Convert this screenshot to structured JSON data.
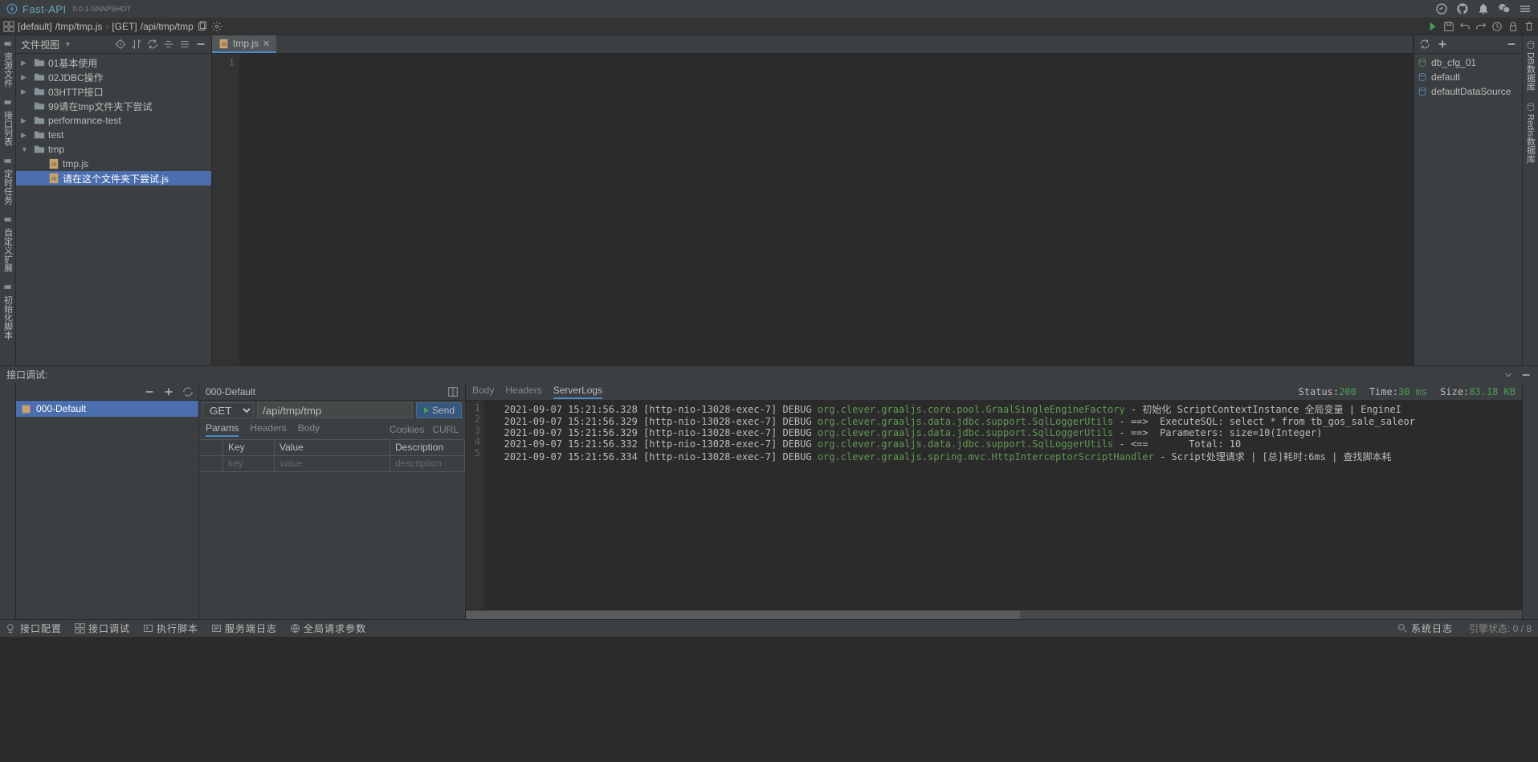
{
  "titlebar": {
    "app_name": "Fast-API",
    "version": "0.0.1-SNAPSHOT"
  },
  "breadcrumb": {
    "default_label": "[default]",
    "path": "/tmp/tmp.js",
    "method": "[GET]",
    "api_path": "/api/tmp/tmp"
  },
  "file_panel": {
    "title": "文件视图"
  },
  "tree": [
    {
      "type": "folder",
      "arrow": "▶",
      "label": "01基本使用",
      "indent": 0,
      "sel": false
    },
    {
      "type": "folder",
      "arrow": "▶",
      "label": "02JDBC操作",
      "indent": 0,
      "sel": false
    },
    {
      "type": "folder",
      "arrow": "▶",
      "label": "03HTTP接口",
      "indent": 0,
      "sel": false
    },
    {
      "type": "folder",
      "arrow": "",
      "label": "99请在tmp文件夹下尝试",
      "indent": 0,
      "sel": false
    },
    {
      "type": "folder",
      "arrow": "▶",
      "label": "performance-test",
      "indent": 0,
      "sel": false
    },
    {
      "type": "folder",
      "arrow": "▶",
      "label": "test",
      "indent": 0,
      "sel": false
    },
    {
      "type": "folder",
      "arrow": "▼",
      "label": "tmp",
      "indent": 0,
      "sel": false
    },
    {
      "type": "js",
      "arrow": "",
      "label": "tmp.js",
      "indent": 1,
      "sel": false
    },
    {
      "type": "js",
      "arrow": "",
      "label": "请在这个文件夹下尝试.js",
      "indent": 1,
      "sel": true
    }
  ],
  "editor": {
    "tab_label": "tmp.js",
    "line_no": "1"
  },
  "db": {
    "items": [
      {
        "label": "db_cfg_01",
        "color": "#629755"
      },
      {
        "label": "default",
        "color": "#5691c8"
      },
      {
        "label": "defaultDataSource",
        "color": "#5691c8"
      }
    ]
  },
  "side_left": [
    "资源文件",
    "接口列表",
    "定时任务",
    "自定义扩展",
    "初始化脚本"
  ],
  "side_right": [
    "DB数据库",
    "Redis数据库"
  ],
  "debug": {
    "title": "接口调试:",
    "req_label": "000-Default",
    "method": "GET",
    "path": "/api/tmp/tmp",
    "send": "Send",
    "tabs_left": [
      "Params",
      "Headers",
      "Body"
    ],
    "tabs_right": [
      "Cookies",
      "CURL"
    ],
    "th_key": "Key",
    "th_val": "Value",
    "th_desc": "Description",
    "ph_key": "key",
    "ph_val": "value",
    "ph_desc": "description"
  },
  "log": {
    "tabs": [
      "Body",
      "Headers",
      "ServerLogs"
    ],
    "status_label": "Status:",
    "status_val": "200",
    "time_label": "Time:",
    "time_val": "30 ms",
    "size_label": "Size:",
    "size_val": "83.18 KB",
    "lines": [
      {
        "ts": "2021-09-07 15:21:56.328",
        "ctx": "[http-nio-13028-exec-7] DEBUG",
        "cls": "org.clever.graaljs.core.pool.GraalSingleEngineFactory",
        "msg": " - 初始化 ScriptContextInstance 全局变量 | EngineI"
      },
      {
        "ts": "2021-09-07 15:21:56.329",
        "ctx": "[http-nio-13028-exec-7] DEBUG",
        "cls": "org.clever.graaljs.data.jdbc.support.SqlLoggerUtils",
        "msg": " - ==>  ExecuteSQL: select * from tb_gos_sale_saleor"
      },
      {
        "ts": "2021-09-07 15:21:56.329",
        "ctx": "[http-nio-13028-exec-7] DEBUG",
        "cls": "org.clever.graaljs.data.jdbc.support.SqlLoggerUtils",
        "msg": " - ==>  Parameters: size=10(Integer)"
      },
      {
        "ts": "2021-09-07 15:21:56.332",
        "ctx": "[http-nio-13028-exec-7] DEBUG",
        "cls": "org.clever.graaljs.data.jdbc.support.SqlLoggerUtils",
        "msg": " - <==       Total: 10"
      },
      {
        "ts": "2021-09-07 15:21:56.334",
        "ctx": "[http-nio-13028-exec-7] DEBUG",
        "cls": "org.clever.graaljs.spring.mvc.HttpInterceptorScriptHandler",
        "msg": " - Script处理请求 | [总]耗时:6ms | 查找脚本耗"
      }
    ]
  },
  "footer": {
    "items": [
      "接口配置",
      "接口调试",
      "执行脚本",
      "服务端日志",
      "全局请求参数"
    ],
    "syslog": "系统日志",
    "engine": "引擎状态: 0 / 8"
  }
}
